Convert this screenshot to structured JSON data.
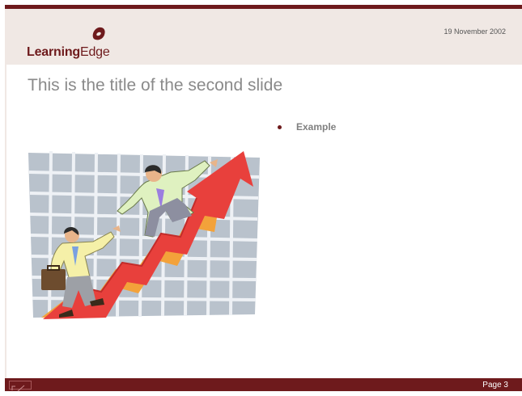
{
  "header": {
    "brand": {
      "bold": "Learning",
      "regular": "Edge"
    },
    "date": "19 November 2002"
  },
  "slide": {
    "title": "This is the title of the second slide",
    "bullets": [
      "Example"
    ],
    "clipart": "business-people-climbing-growth-arrow"
  },
  "footer": {
    "page": "Page 3"
  },
  "colors": {
    "brand": "#6e1a1c",
    "header_band": "#f0e8e4",
    "title_text": "#8a8a8a",
    "arrow": "#e8403c"
  }
}
